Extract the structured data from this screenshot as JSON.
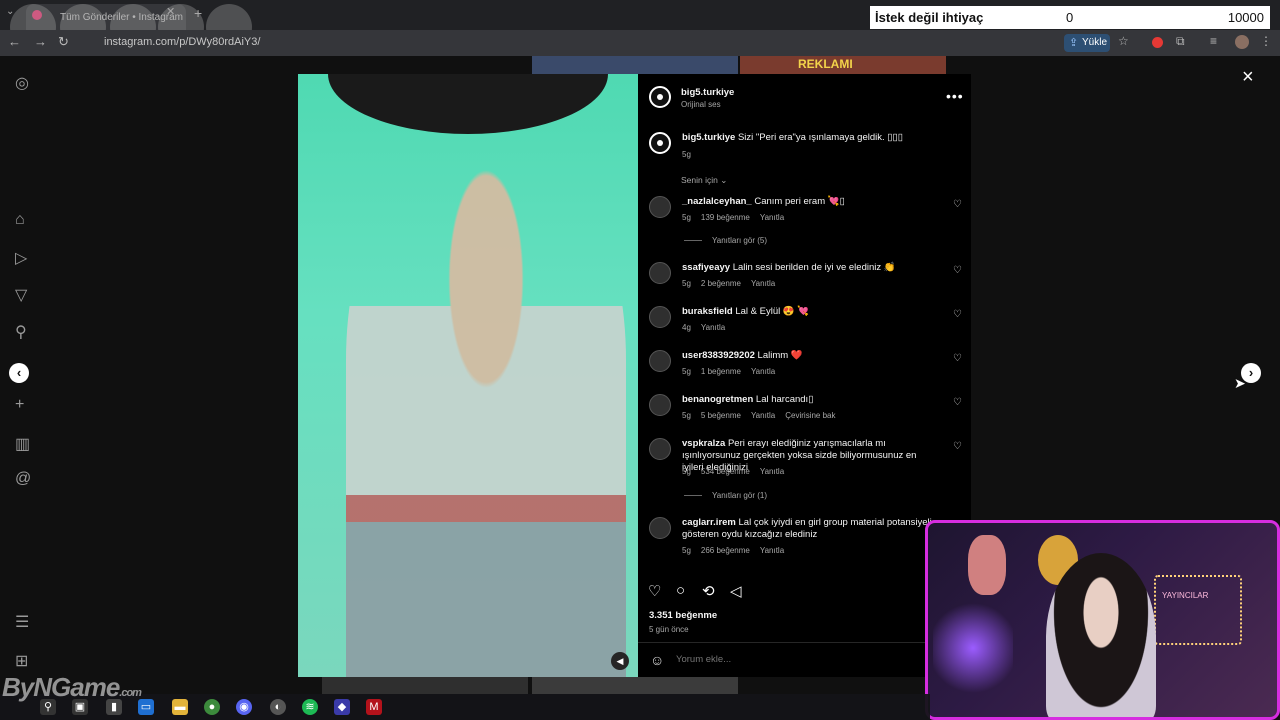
{
  "browser": {
    "tab_title": "Tüm Gönderiler • Instagram",
    "url": "instagram.com/p/DWy80rdAiY3/",
    "upload_label": "Yükle"
  },
  "goal": {
    "label": "İstek değil ihtiyaç",
    "current": "0",
    "target": "10000"
  },
  "post": {
    "author": "big5.turkiye",
    "audio": "Orijinal ses",
    "caption_user": "big5.turkiye",
    "caption_text": "Sizi \"Peri era\"ya ışınlamaya geldik. ▯▯▯",
    "caption_time": "5g",
    "sort_label": "Senin için",
    "likes": "3.351 beğenme",
    "posted": "5 gün önce",
    "comment_placeholder": "Yorum ekle..."
  },
  "comments": [
    {
      "user": "_nazlalceyhan_",
      "text": "Canım peri eram 💘▯",
      "meta": [
        "5g",
        "139 beğenme",
        "Yanıtla"
      ],
      "replies": "Yanıtları gör (5)"
    },
    {
      "user": "ssafiyeayy",
      "text": "Lalin sesi berilden de iyi ve elediniz 👏",
      "meta": [
        "5g",
        "2 beğenme",
        "Yanıtla"
      ]
    },
    {
      "user": "buraksfield",
      "text": "Lal & Eylül 😍 💘",
      "meta": [
        "4g",
        "Yanıtla"
      ]
    },
    {
      "user": "user8383929202",
      "text": "Lalimm ❤️",
      "meta": [
        "5g",
        "1 beğenme",
        "Yanıtla"
      ]
    },
    {
      "user": "benanogretmen",
      "text": "Lal harcandı▯",
      "meta": [
        "5g",
        "5 beğenme",
        "Yanıtla",
        "Çevirisine bak"
      ]
    },
    {
      "user": "vspkralza",
      "text": "Peri erayı elediğiniz yarışmacılarla mı ışınlıyorsunuz gerçekten yoksa sizde biliyormusunuz en iyileri elediğinizi",
      "meta": [
        "5g",
        "534 beğenme",
        "Yanıtla"
      ],
      "replies": "Yanıtları gör (1)"
    },
    {
      "user": "caglarr.irem",
      "text": "Lal çok iyiydi en girl group material potansiyeli gösteren oydu kızcağızı elediniz",
      "meta": [
        "5g",
        "266 beğenme",
        "Yanıtla"
      ]
    }
  ],
  "overlay": {
    "watermark_main": "ByNGame",
    "watermark_suffix": ".com",
    "banner_text": "REKLAMI",
    "cam_sign": "YAYINCILAR"
  },
  "icons": {
    "close": "×",
    "prev": "‹",
    "next": "›",
    "more": "•••",
    "heart": "♡",
    "comment": "○",
    "share": "⟲",
    "send": "◁",
    "emoji": "☺",
    "mute": "◀"
  }
}
